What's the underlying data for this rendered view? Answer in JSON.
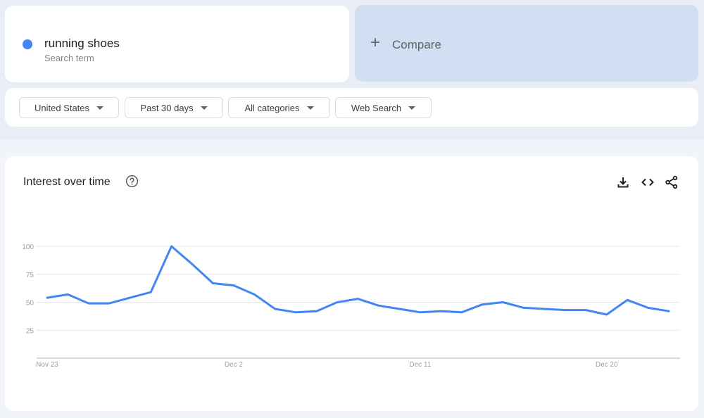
{
  "search_term": {
    "name": "running shoes",
    "subtitle": "Search term",
    "color": "#4285f4"
  },
  "compare": {
    "icon": "plus-icon",
    "plus_glyph": "+",
    "label": "Compare"
  },
  "filters": [
    {
      "label": "United States"
    },
    {
      "label": "Past 30 days"
    },
    {
      "label": "All categories"
    },
    {
      "label": "Web Search"
    }
  ],
  "chart_panel": {
    "title": "Interest over time",
    "help_icon": "help-circle-icon",
    "actions": [
      "download-icon",
      "embed-code-icon",
      "share-icon"
    ]
  },
  "chart_data": {
    "type": "line",
    "title": "Interest over time",
    "xlabel": "",
    "ylabel": "",
    "ylim": [
      0,
      100
    ],
    "yticks": [
      25,
      50,
      75,
      100
    ],
    "ytick_labels": [
      "25",
      "50",
      "75",
      "100"
    ],
    "xtick_labels": [
      "Nov 23",
      "Dec 2",
      "Dec 11",
      "Dec 20"
    ],
    "xtick_indices": [
      0,
      9,
      18,
      27
    ],
    "grid": true,
    "x": [
      "Nov 23",
      "Nov 24",
      "Nov 25",
      "Nov 26",
      "Nov 27",
      "Nov 28",
      "Nov 29",
      "Nov 30",
      "Dec 1",
      "Dec 2",
      "Dec 3",
      "Dec 4",
      "Dec 5",
      "Dec 6",
      "Dec 7",
      "Dec 8",
      "Dec 9",
      "Dec 10",
      "Dec 11",
      "Dec 12",
      "Dec 13",
      "Dec 14",
      "Dec 15",
      "Dec 16",
      "Dec 17",
      "Dec 18",
      "Dec 19",
      "Dec 20",
      "Dec 21",
      "Dec 22",
      "Dec 23"
    ],
    "series": [
      {
        "name": "running shoes",
        "color": "#4285f4",
        "values": [
          54,
          57,
          49,
          49,
          54,
          59,
          100,
          84,
          67,
          65,
          57,
          44,
          41,
          42,
          50,
          53,
          47,
          44,
          41,
          42,
          41,
          48,
          50,
          45,
          44,
          43,
          43,
          39,
          52,
          45,
          42
        ]
      }
    ]
  }
}
